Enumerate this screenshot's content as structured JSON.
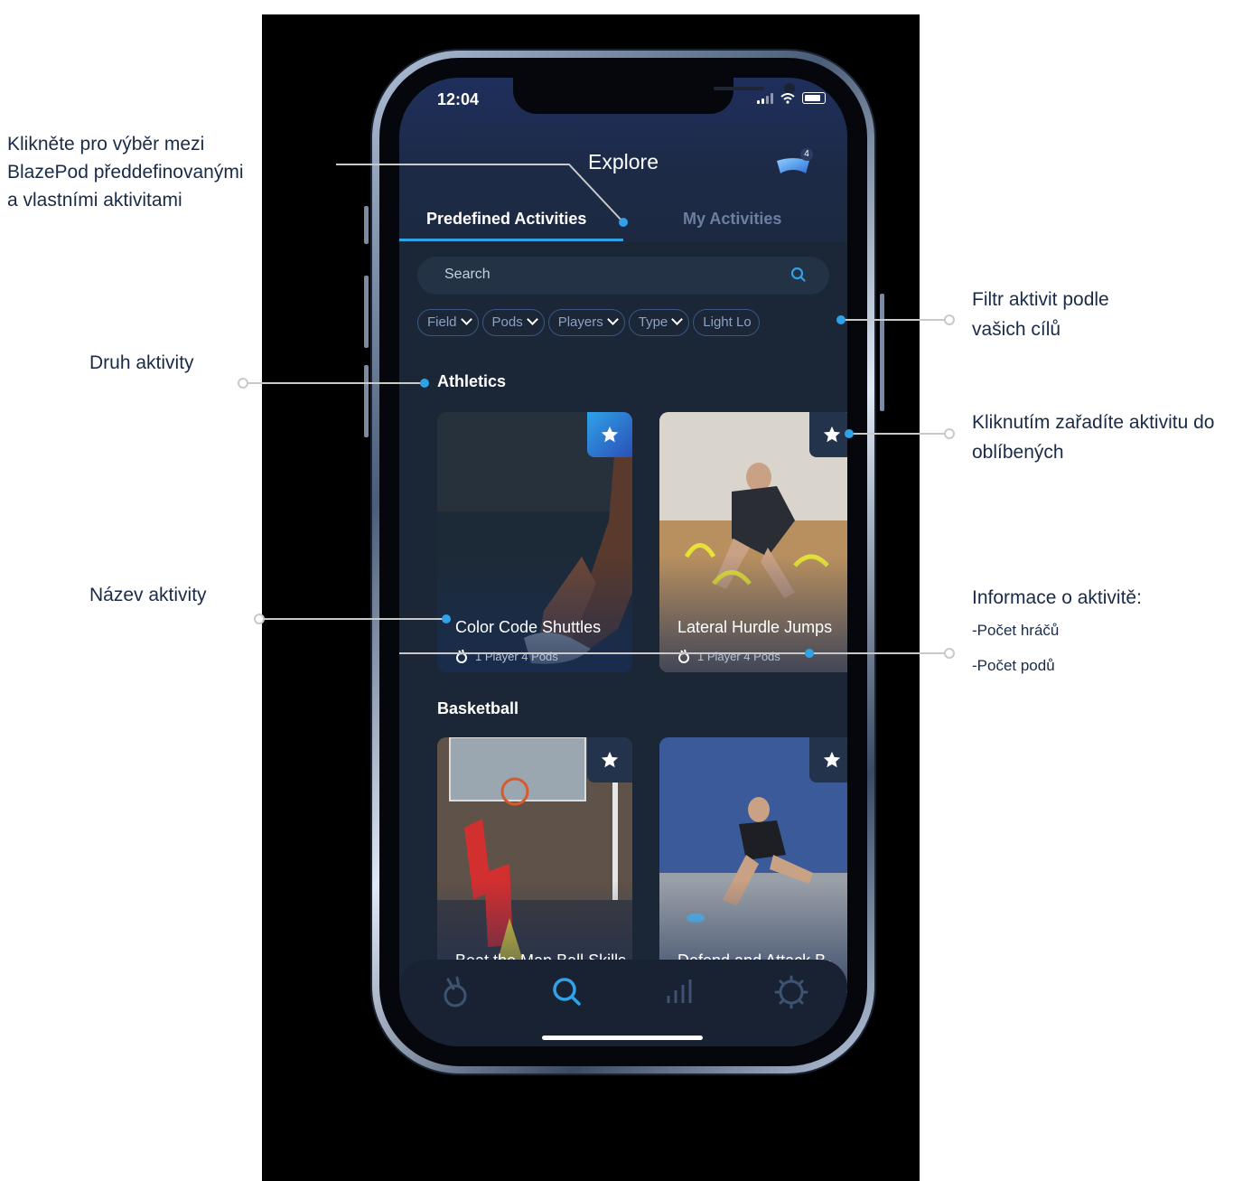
{
  "status_bar": {
    "time": "12:04"
  },
  "header": {
    "title": "Explore",
    "pods_badge": "4"
  },
  "tabs": [
    {
      "label": "Predefined Activities",
      "active": true
    },
    {
      "label": "My Activities",
      "active": false
    }
  ],
  "search": {
    "placeholder": "Search"
  },
  "filters": [
    "Field",
    "Pods",
    "Players",
    "Type",
    "Light Lo"
  ],
  "sections": [
    {
      "title": "Athletics",
      "cards": [
        {
          "title": "Color Code Shuttles",
          "meta": "1 Player  4 Pods",
          "favorite_style": "highlighted"
        },
        {
          "title": "Lateral Hurdle Jumps",
          "meta": "1 Player  4 Pods",
          "favorite_style": "default"
        }
      ]
    },
    {
      "title": "Basketball",
      "cards": [
        {
          "title": "Beat the Man Ball Skills Basketball",
          "meta": "",
          "favorite_style": "default"
        },
        {
          "title": "Defend and Attack B-ball Switcharoo",
          "meta": "",
          "favorite_style": "default"
        }
      ]
    }
  ],
  "bottom_nav": [
    "pods-icon",
    "search-icon",
    "stats-icon",
    "settings-icon"
  ],
  "annotations": {
    "switch_tabs_lines": [
      "Klikněte pro výběr mezi",
      "BlazePod předdefinovanými",
      "a vlastními aktivitami"
    ],
    "activity_type": "Druh aktivity",
    "activity_name": "Název aktivity",
    "filter_lines": [
      "Filtr aktivit podle",
      "vašich cílů"
    ],
    "favorite_lines": [
      "Kliknutím zařadíte aktivitu do",
      "oblíbených"
    ],
    "info_title": "Informace o aktivitě:",
    "info_players": "-Počet hráčů",
    "info_pods": "-Počet podů"
  },
  "colors": {
    "accent": "#2fa2e8",
    "background": "#1b2637",
    "annotation_text": "#1a2b47",
    "callout_line": "#c9c9c9"
  }
}
